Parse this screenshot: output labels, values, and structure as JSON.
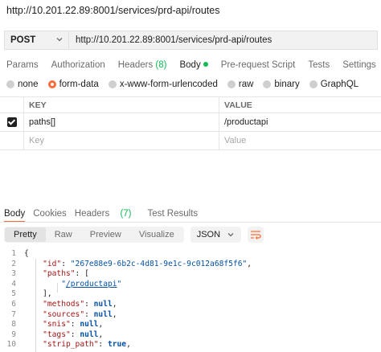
{
  "request_title": "http://10.201.22.89:8001/services/prd-api/routes",
  "method": "POST",
  "url": "http://10.201.22.89:8001/services/prd-api/routes",
  "request_tabs": [
    {
      "label": "Params"
    },
    {
      "label": "Authorization"
    },
    {
      "label": "Headers",
      "count": "(8)"
    },
    {
      "label": "Body"
    },
    {
      "label": "Pre-request Script"
    },
    {
      "label": "Tests"
    },
    {
      "label": "Settings"
    }
  ],
  "body_types": [
    "none",
    "form-data",
    "x-www-form-urlencoded",
    "raw",
    "binary",
    "GraphQL"
  ],
  "kv_table": {
    "key_header": "KEY",
    "value_header": "VALUE",
    "rows": [
      {
        "key": "paths[]",
        "value": "/productapi"
      }
    ],
    "key_placeholder": "Key",
    "value_placeholder": "Value"
  },
  "response_tabs": [
    {
      "label": "Body"
    },
    {
      "label": "Cookies"
    },
    {
      "label": "Headers",
      "count": "(7)"
    },
    {
      "label": "Test Results"
    }
  ],
  "view_modes": [
    "Pretty",
    "Raw",
    "Preview",
    "Visualize"
  ],
  "format": "JSON",
  "code": {
    "line_numbers": [
      "1",
      "2",
      "3",
      "4",
      "5",
      "6",
      "7",
      "8",
      "9",
      "10"
    ],
    "open_brace": "{",
    "id_key": "\"id\"",
    "id_value": "\"267e88e9-6b2c-4d81-9e1c-9c012a68f5f6\"",
    "paths_key": "\"paths\"",
    "paths_open": "[",
    "path_value": "/productapi",
    "quote": "\"",
    "paths_close": "],",
    "methods_key": "\"methods\"",
    "sources_key": "\"sources\"",
    "snis_key": "\"snis\"",
    "tags_key": "\"tags\"",
    "strip_path_key": "\"strip_path\"",
    "null": "null",
    "true": "true"
  },
  "colors": {
    "accent": "#ff6c37",
    "success": "#0cbb52"
  }
}
